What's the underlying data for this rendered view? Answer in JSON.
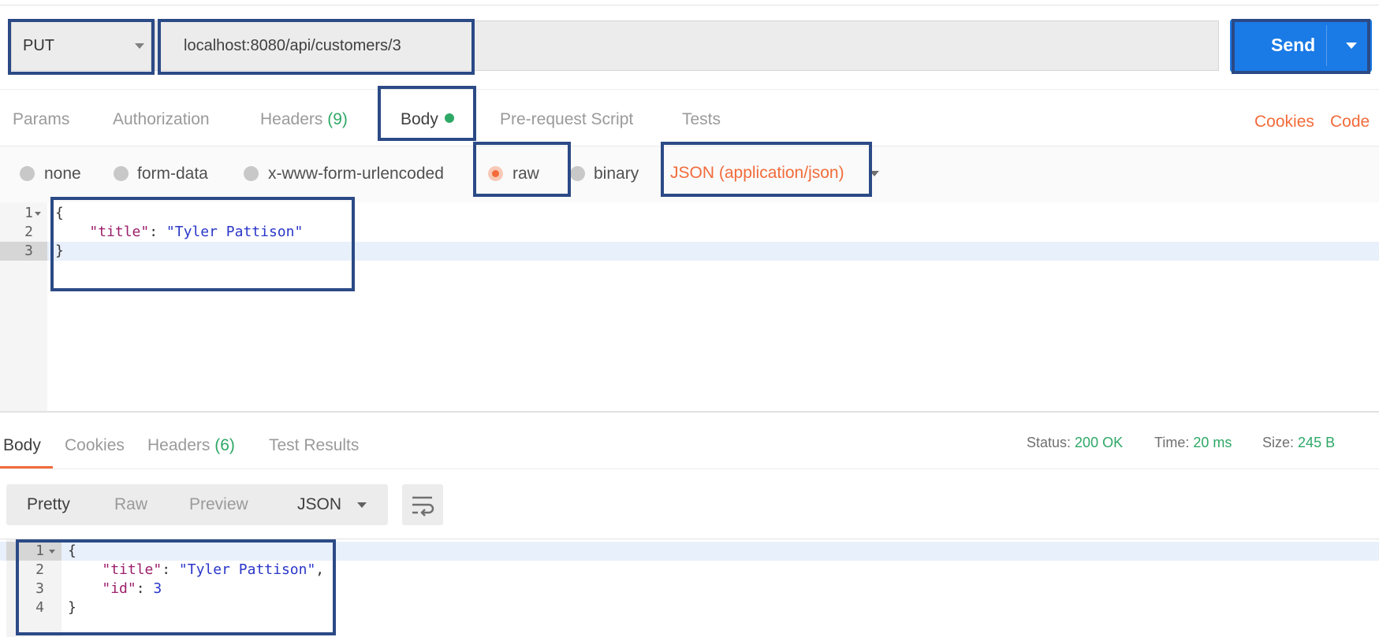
{
  "request": {
    "method": "PUT",
    "url": "localhost:8080/api/customers/3",
    "send_label": "Send"
  },
  "request_tabs": {
    "params": "Params",
    "authorization": "Authorization",
    "headers": "Headers",
    "headers_count": "(9)",
    "body": "Body",
    "prerequest": "Pre-request Script",
    "tests": "Tests",
    "cookies": "Cookies",
    "code": "Code"
  },
  "body_types": {
    "none": "none",
    "form_data": "form-data",
    "urlencoded": "x-www-form-urlencoded",
    "raw": "raw",
    "binary": "binary",
    "selected": "raw",
    "content_type": "JSON (application/json)"
  },
  "request_body": {
    "line_numbers": [
      "1",
      "2",
      "3"
    ],
    "open_brace": "{",
    "indent": "    ",
    "key": "\"title\"",
    "colon": ": ",
    "value": "\"Tyler Pattison\"",
    "close_brace": "}"
  },
  "response_tabs": {
    "body": "Body",
    "cookies": "Cookies",
    "headers": "Headers",
    "headers_count": "(6)",
    "test_results": "Test Results"
  },
  "response_status": {
    "status_label": "Status:",
    "status_value": "200 OK",
    "time_label": "Time:",
    "time_value": "20 ms",
    "size_label": "Size:",
    "size_value": "245 B"
  },
  "view_options": {
    "pretty": "Pretty",
    "raw": "Raw",
    "preview": "Preview",
    "format": "JSON"
  },
  "response_body": {
    "line_numbers": [
      "1",
      "2",
      "3",
      "4"
    ],
    "open_brace": "{",
    "indent": "    ",
    "title_key": "\"title\"",
    "colon": ": ",
    "title_value": "\"Tyler Pattison\"",
    "comma": ",",
    "id_key": "\"id\"",
    "id_value": "3",
    "close_brace": "}"
  },
  "colors": {
    "accent_orange": "#f26b3a",
    "send_blue": "#1a7ae6",
    "success_green": "#2ea866",
    "highlight_box": "#2b4a86"
  }
}
